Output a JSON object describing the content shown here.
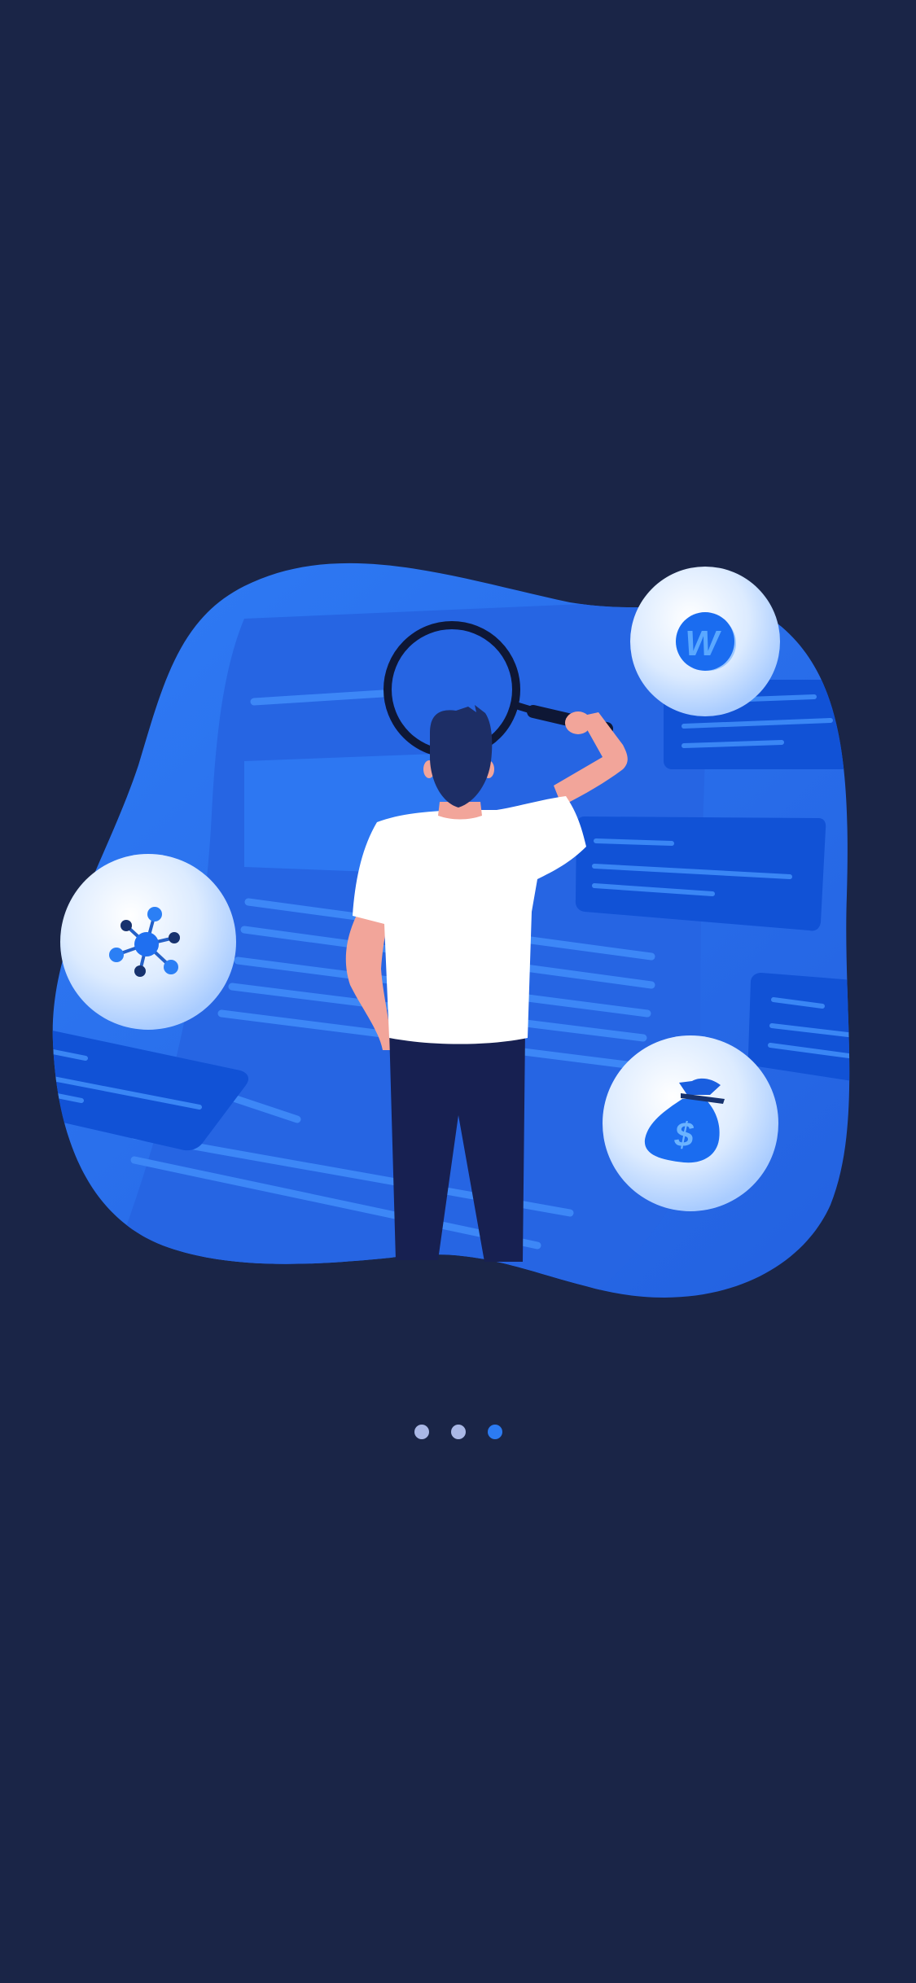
{
  "screen": {
    "name": "onboarding-step-3",
    "background_color": "#1a2547"
  },
  "illustration": {
    "subject": "person-with-magnifying-glass",
    "icons": [
      "network-nodes-icon",
      "coin-w-icon",
      "money-bag-dollar-icon"
    ],
    "coin_letter": "W",
    "money_bag_symbol": "$",
    "colors": {
      "blob": "#2a6ff0",
      "panels": "#1152d6",
      "shirt": "#ffffff",
      "pants": "#172051",
      "hair": "#1d2e66",
      "skin": "#f2a59a"
    }
  },
  "pagination": {
    "total": 3,
    "active_index": 2,
    "active_color": "#2c7bf2",
    "inactive_color": "#aab8e6"
  }
}
